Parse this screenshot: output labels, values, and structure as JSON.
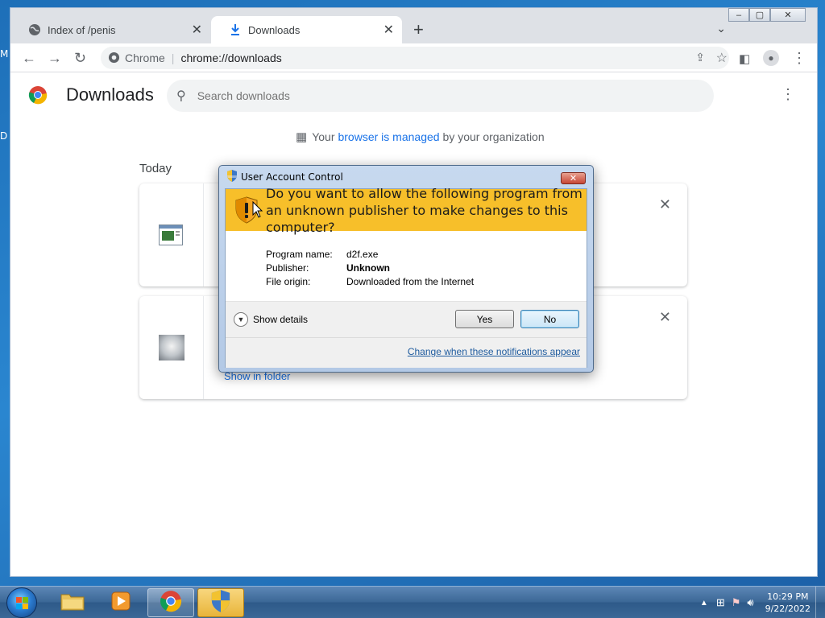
{
  "desktop": {
    "edge_letters": [
      "M",
      "D"
    ]
  },
  "browser": {
    "tabs": [
      {
        "label": "Index of /penis",
        "active": false
      },
      {
        "label": "Downloads",
        "active": true
      }
    ],
    "new_tab_label": "+",
    "omnibox": {
      "site_label": "Chrome",
      "url": "chrome://downloads"
    }
  },
  "downloads_page": {
    "title": "Downloads",
    "search_placeholder": "Search downloads",
    "managed_notice": {
      "prefix": "Your",
      "link": "browser is managed",
      "suffix": "by your organization"
    },
    "section_label": "Today",
    "items": [
      {
        "thumb": "window-app-icon"
      },
      {
        "thumb": "cat-image",
        "show_in_folder": "Show in folder"
      }
    ]
  },
  "uac": {
    "title": "User Account Control",
    "question": "Do you want to allow the following program from an unknown publisher to make changes to this computer?",
    "fields": [
      {
        "label": "Program name:",
        "value": "d2f.exe",
        "bold": false
      },
      {
        "label": "Publisher:",
        "value": "Unknown",
        "bold": true
      },
      {
        "label": "File origin:",
        "value": "Downloaded from the Internet",
        "bold": false
      }
    ],
    "show_details": "Show details",
    "yes": "Yes",
    "no": "No",
    "change_link": "Change when these notifications appear",
    "accent": "#f7bf2a"
  },
  "taskbar": {
    "items": [
      "explorer-icon",
      "media-player-icon",
      "chrome-icon",
      "uac-shield-icon"
    ],
    "clock": {
      "time": "10:29 PM",
      "date": "9/22/2022"
    }
  }
}
